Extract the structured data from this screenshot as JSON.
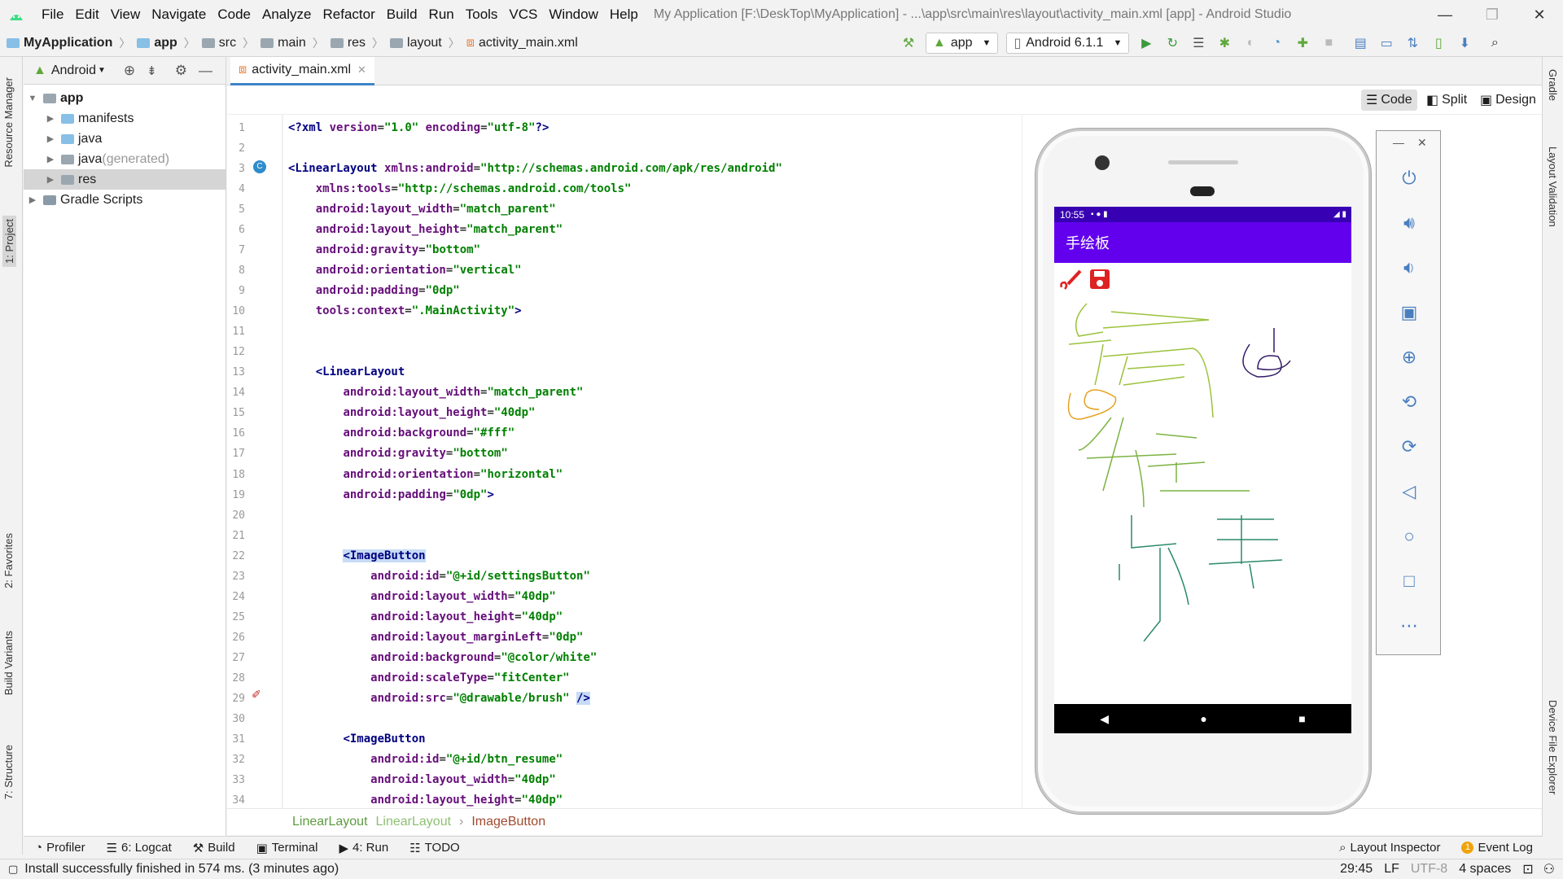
{
  "window": {
    "title": "My Application [F:\\DeskTop\\MyApplication] - ...\\app\\src\\main\\res\\layout\\activity_main.xml [app] - Android Studio",
    "controls": [
      "—",
      "❐",
      "✕"
    ]
  },
  "menu": [
    "File",
    "Edit",
    "View",
    "Navigate",
    "Code",
    "Analyze",
    "Refactor",
    "Build",
    "Run",
    "Tools",
    "VCS",
    "Window",
    "Help"
  ],
  "breadcrumbs": [
    "MyApplication",
    "app",
    "src",
    "main",
    "res",
    "layout",
    "activity_main.xml"
  ],
  "toolbar": {
    "run_config": "app",
    "device": "Android 6.1.1"
  },
  "left_tabs": [
    "Resource Manager",
    "1: Project",
    "2: Favorites",
    "Build Variants",
    "7: Structure"
  ],
  "right_tabs": [
    "Gradle",
    "Layout Validation",
    "Device File Explorer"
  ],
  "project": {
    "view_mode": "Android",
    "tree": [
      {
        "label": "app",
        "level": 0,
        "expanded": true,
        "bold": true
      },
      {
        "label": "manifests",
        "level": 1
      },
      {
        "label": "java",
        "level": 1
      },
      {
        "label": "java",
        "suffix": " (generated)",
        "level": 1
      },
      {
        "label": "res",
        "level": 1,
        "selected": true
      },
      {
        "label": "Gradle Scripts",
        "level": 0
      }
    ]
  },
  "editor": {
    "tab": "activity_main.xml",
    "modes": [
      "Code",
      "Split",
      "Design"
    ],
    "current_line": 29,
    "lines": [
      [
        [
          "t",
          "<?xml "
        ],
        [
          "a",
          "version"
        ],
        [
          "p",
          "="
        ],
        [
          "v",
          "\"1.0\""
        ],
        [
          "p",
          " "
        ],
        [
          "a",
          "encoding"
        ],
        [
          "p",
          "="
        ],
        [
          "v",
          "\"utf-8\""
        ],
        [
          "t",
          "?>"
        ]
      ],
      [],
      [
        [
          "t",
          "<LinearLayout "
        ],
        [
          "a",
          "xmlns:android"
        ],
        [
          "p",
          "="
        ],
        [
          "v",
          "\"http://schemas.android.com/apk/res/android\""
        ]
      ],
      [
        [
          "p",
          "    "
        ],
        [
          "a",
          "xmlns:tools"
        ],
        [
          "p",
          "="
        ],
        [
          "v",
          "\"http://schemas.android.com/tools\""
        ]
      ],
      [
        [
          "p",
          "    "
        ],
        [
          "a",
          "android:layout_width"
        ],
        [
          "p",
          "="
        ],
        [
          "v",
          "\"match_parent\""
        ]
      ],
      [
        [
          "p",
          "    "
        ],
        [
          "a",
          "android:layout_height"
        ],
        [
          "p",
          "="
        ],
        [
          "v",
          "\"match_parent\""
        ]
      ],
      [
        [
          "p",
          "    "
        ],
        [
          "a",
          "android:gravity"
        ],
        [
          "p",
          "="
        ],
        [
          "v",
          "\"bottom\""
        ]
      ],
      [
        [
          "p",
          "    "
        ],
        [
          "a",
          "android:orientation"
        ],
        [
          "p",
          "="
        ],
        [
          "v",
          "\"vertical\""
        ]
      ],
      [
        [
          "p",
          "    "
        ],
        [
          "a",
          "android:padding"
        ],
        [
          "p",
          "="
        ],
        [
          "v",
          "\"0dp\""
        ]
      ],
      [
        [
          "p",
          "    "
        ],
        [
          "a",
          "tools:context"
        ],
        [
          "p",
          "="
        ],
        [
          "v",
          "\".MainActivity\""
        ],
        [
          "t",
          ">"
        ]
      ],
      [],
      [],
      [
        [
          "p",
          "    "
        ],
        [
          "t",
          "<LinearLayout"
        ]
      ],
      [
        [
          "p",
          "        "
        ],
        [
          "a",
          "android:layout_width"
        ],
        [
          "p",
          "="
        ],
        [
          "v",
          "\"match_parent\""
        ]
      ],
      [
        [
          "p",
          "        "
        ],
        [
          "a",
          "android:layout_height"
        ],
        [
          "p",
          "="
        ],
        [
          "v",
          "\"40dp\""
        ]
      ],
      [
        [
          "p",
          "        "
        ],
        [
          "a",
          "android:background"
        ],
        [
          "p",
          "="
        ],
        [
          "v",
          "\"#fff\""
        ]
      ],
      [
        [
          "p",
          "        "
        ],
        [
          "a",
          "android:gravity"
        ],
        [
          "p",
          "="
        ],
        [
          "v",
          "\"bottom\""
        ]
      ],
      [
        [
          "p",
          "        "
        ],
        [
          "a",
          "android:orientation"
        ],
        [
          "p",
          "="
        ],
        [
          "v",
          "\"horizontal\""
        ]
      ],
      [
        [
          "p",
          "        "
        ],
        [
          "a",
          "android:padding"
        ],
        [
          "p",
          "="
        ],
        [
          "v",
          "\"0dp\""
        ],
        [
          "t",
          ">"
        ]
      ],
      [],
      [],
      [
        [
          "p",
          "        "
        ],
        [
          "h",
          "<ImageButton"
        ]
      ],
      [
        [
          "p",
          "            "
        ],
        [
          "a",
          "android:id"
        ],
        [
          "p",
          "="
        ],
        [
          "v",
          "\"@+id/settingsButton\""
        ]
      ],
      [
        [
          "p",
          "            "
        ],
        [
          "a",
          "android:layout_width"
        ],
        [
          "p",
          "="
        ],
        [
          "v",
          "\"40dp\""
        ]
      ],
      [
        [
          "p",
          "            "
        ],
        [
          "a",
          "android:layout_height"
        ],
        [
          "p",
          "="
        ],
        [
          "v",
          "\"40dp\""
        ]
      ],
      [
        [
          "p",
          "            "
        ],
        [
          "a",
          "android:layout_marginLeft"
        ],
        [
          "p",
          "="
        ],
        [
          "v",
          "\"0dp\""
        ]
      ],
      [
        [
          "p",
          "            "
        ],
        [
          "a",
          "android:background"
        ],
        [
          "p",
          "="
        ],
        [
          "v",
          "\"@color/white\""
        ]
      ],
      [
        [
          "p",
          "            "
        ],
        [
          "a",
          "android:scaleType"
        ],
        [
          "p",
          "="
        ],
        [
          "v",
          "\"fitCenter\""
        ]
      ],
      [
        [
          "p",
          "            "
        ],
        [
          "a",
          "android:src"
        ],
        [
          "p",
          "="
        ],
        [
          "v",
          "\"@drawable/brush\""
        ],
        [
          "p",
          " "
        ],
        [
          "h",
          "/>"
        ]
      ],
      [],
      [
        [
          "p",
          "        "
        ],
        [
          "t",
          "<ImageButton"
        ]
      ],
      [
        [
          "p",
          "            "
        ],
        [
          "a",
          "android:id"
        ],
        [
          "p",
          "="
        ],
        [
          "v",
          "\"@+id/btn_resume\""
        ]
      ],
      [
        [
          "p",
          "            "
        ],
        [
          "a",
          "android:layout_width"
        ],
        [
          "p",
          "="
        ],
        [
          "v",
          "\"40dp\""
        ]
      ],
      [
        [
          "p",
          "            "
        ],
        [
          "a",
          "android:layout_height"
        ],
        [
          "p",
          "="
        ],
        [
          "v",
          "\"40dp\""
        ]
      ]
    ],
    "path": [
      "LinearLayout",
      "LinearLayout",
      "ImageButton"
    ]
  },
  "phone": {
    "time": "10:55",
    "app_title": "手绘板",
    "app_bar_color": "#6200ee",
    "status_bar_color": "#3700b3"
  },
  "tool_windows": [
    "Profiler",
    "6: Logcat",
    "Build",
    "Terminal",
    "4: Run",
    "TODO"
  ],
  "tool_windows_right": [
    "Layout Inspector",
    "Event Log"
  ],
  "event_count": "1",
  "status": {
    "message": "Install successfully finished in 574 ms. (3 minutes ago)",
    "position": "29:45",
    "line_sep": "LF",
    "encoding": "UTF-8",
    "indent": "4 spaces"
  }
}
